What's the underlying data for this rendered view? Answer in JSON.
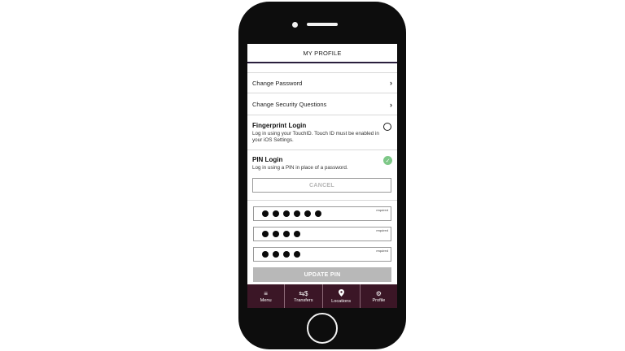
{
  "header": {
    "title": "MY PROFILE"
  },
  "menu_rows": [
    {
      "label": "Change Password",
      "icon": "chevron-right-icon",
      "glyph": "›"
    },
    {
      "label": "Change Security Questions",
      "icon": "chevron-right-icon",
      "glyph": "›"
    }
  ],
  "fingerprint": {
    "title": "Fingerprint Login",
    "description": "Log in using your TouchID. Touch ID must be enabled in your iOS Settings.",
    "enabled": false
  },
  "pin_login": {
    "title": "PIN Login",
    "description": "Log in using a PIN in place of a password.",
    "enabled": true,
    "check_glyph": "✓",
    "cancel_label": "CANCEL"
  },
  "pin_fields": [
    {
      "required_label": "required",
      "masked_length": 6
    },
    {
      "required_label": "required",
      "masked_length": 4
    },
    {
      "required_label": "required",
      "masked_length": 4
    }
  ],
  "update_button": {
    "label": "UPDATE PIN"
  },
  "tabs": [
    {
      "label": "Menu",
      "icon": "hamburger-menu-icon",
      "glyph": "≡"
    },
    {
      "label": "Transfers",
      "icon": "transfer-dollar-icon",
      "glyph": "⇆$"
    },
    {
      "label": "Locations",
      "icon": "map-pin-icon",
      "glyph": "⬤"
    },
    {
      "label": "Profile",
      "icon": "gear-icon",
      "glyph": "⚙"
    }
  ],
  "colors": {
    "tabbar": "#3b1626",
    "header_rule": "#2a1f3d",
    "toggle_on": "#7ec888",
    "update_disabled": "#b8b8b8"
  }
}
